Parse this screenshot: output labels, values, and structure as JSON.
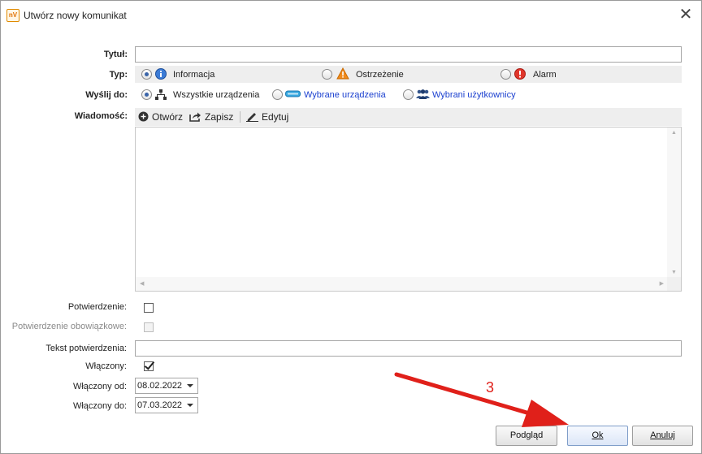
{
  "window": {
    "title": "Utwórz nowy komunikat",
    "app_icon_text": "nV",
    "close_glyph": "✕"
  },
  "form": {
    "tytul_label": "Tytuł:",
    "tytul_value": "",
    "typ_label": "Typ:",
    "typ_options": [
      {
        "label": "Informacja",
        "checked": true,
        "icon": "info-icon"
      },
      {
        "label": "Ostrzeżenie",
        "checked": false,
        "icon": "warning-icon"
      },
      {
        "label": "Alarm",
        "checked": false,
        "icon": "alarm-icon"
      }
    ],
    "wyslij_label": "Wyślij do:",
    "wyslij_options": [
      {
        "label": "Wszystkie urządzenia",
        "checked": true,
        "icon": "network-icon"
      },
      {
        "label": "Wybrane urządzenia",
        "checked": false,
        "icon": "device-icon"
      },
      {
        "label": "Wybrani użytkownicy",
        "checked": false,
        "icon": "users-icon"
      }
    ],
    "wiadomosc_label": "Wiadomość:",
    "toolbar": {
      "open_label": "Otwórz",
      "save_label": "Zapisz",
      "edit_label": "Edytuj"
    },
    "message_value": "",
    "potwierdzenie_label": "Potwierdzenie:",
    "potwierdzenie_checked": false,
    "potwierdzenie_obow_label": "Potwierdzenie obowiązkowe:",
    "potwierdzenie_obow_checked": false,
    "tekst_potw_label": "Tekst potwierdzenia:",
    "tekst_potw_value": "",
    "wlaczony_label": "Włączony:",
    "wlaczony_checked": true,
    "wlaczony_od_label": "Włączony od:",
    "wlaczony_od_value": "08.02.2022",
    "wlaczony_do_label": "Włączony do:",
    "wlaczony_do_value": "07.03.2022"
  },
  "buttons": {
    "preview_label": "Podgląd",
    "ok_label": "Ok",
    "cancel_label": "Anuluj"
  },
  "annotation": {
    "step_number": "3",
    "color": "#e0201a"
  }
}
